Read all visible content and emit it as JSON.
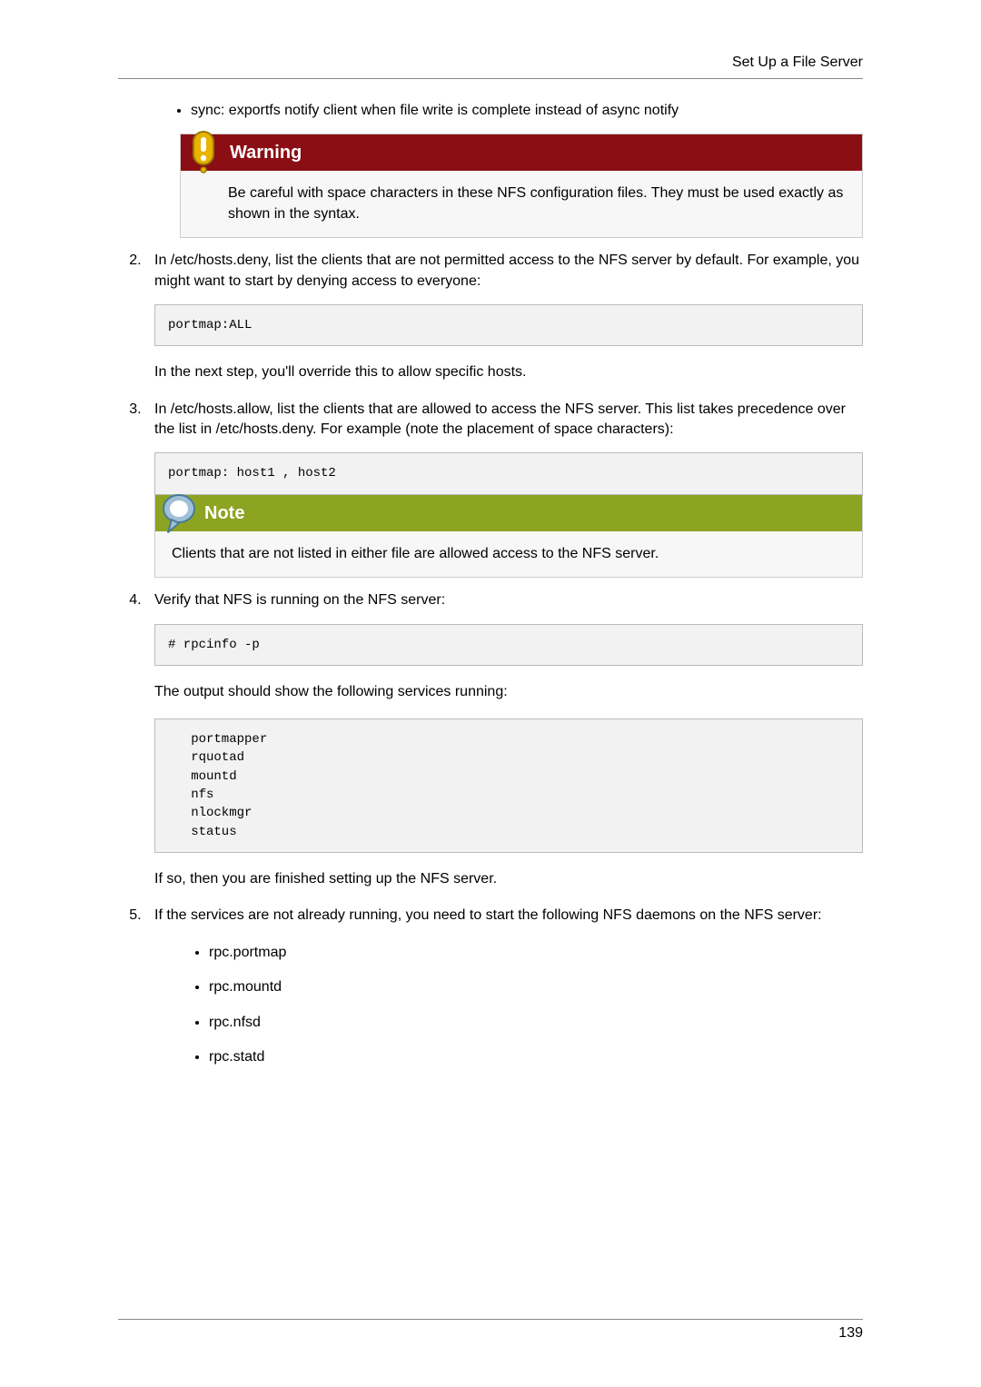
{
  "header": {
    "title": "Set Up a File Server"
  },
  "intro_bullet": "sync: exportfs notify client when file write is complete instead of async notify",
  "warning": {
    "title": "Warning",
    "body": "Be careful with space characters in these NFS configuration files. They must be used exactly as shown in the syntax."
  },
  "steps": {
    "step2": {
      "text": "In /etc/hosts.deny, list the clients that are not permitted access to the NFS server by default. For example, you might want to start by denying access to everyone:",
      "code": "portmap:ALL",
      "after": "In the next step, you'll override this to allow specific hosts."
    },
    "step3": {
      "text": "In /etc/hosts.allow, list the clients that are allowed to access the NFS server. This list takes precedence over the list in /etc/hosts.deny. For example (note the placement of space characters):",
      "code": "portmap: host1 , host2",
      "note": {
        "title": "Note",
        "body": "Clients that are not listed in either file are allowed access to the NFS server."
      }
    },
    "step4": {
      "text": "Verify that NFS is running on the NFS server:",
      "code": "# rpcinfo -p",
      "after1": "The output should show the following services running:",
      "code2": "   portmapper\n   rquotad\n   mountd\n   nfs\n   nlockmgr\n   status",
      "after2": "If so, then you are finished setting up the NFS server."
    },
    "step5": {
      "text": "If the services are not already running, you need to start the following NFS daemons on the NFS server:",
      "items": [
        "rpc.portmap",
        "rpc.mountd",
        "rpc.nfsd",
        "rpc.statd"
      ]
    }
  },
  "footer": {
    "page_number": "139"
  }
}
